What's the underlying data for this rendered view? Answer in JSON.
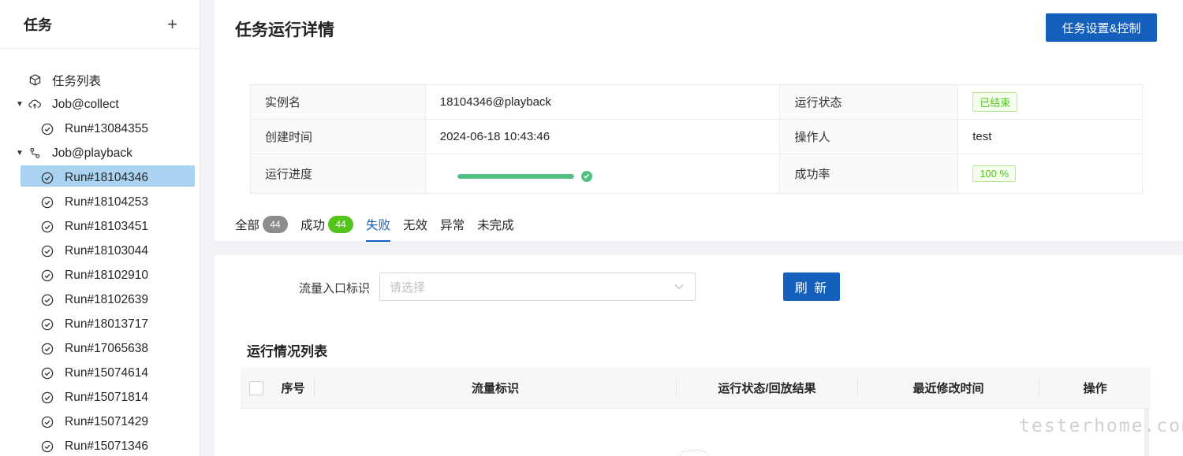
{
  "sidebar": {
    "title": "任务",
    "add_icon": "plus-icon",
    "items": [
      {
        "label": "任务列表",
        "icon": "cube-icon"
      },
      {
        "label": "Job@collect",
        "icon": "cloud-upload-icon"
      },
      {
        "label": "Run#13084355",
        "icon": "check-circle-icon"
      },
      {
        "label": "Job@playback",
        "icon": "branch-icon"
      },
      {
        "label": "Run#18104346",
        "icon": "check-circle-icon",
        "selected": true
      },
      {
        "label": "Run#18104253",
        "icon": "check-circle-icon"
      },
      {
        "label": "Run#18103451",
        "icon": "check-circle-icon"
      },
      {
        "label": "Run#18103044",
        "icon": "check-circle-icon"
      },
      {
        "label": "Run#18102910",
        "icon": "check-circle-icon"
      },
      {
        "label": "Run#18102639",
        "icon": "check-circle-icon"
      },
      {
        "label": "Run#18013717",
        "icon": "check-circle-icon"
      },
      {
        "label": "Run#17065638",
        "icon": "check-circle-icon"
      },
      {
        "label": "Run#15074614",
        "icon": "check-circle-icon"
      },
      {
        "label": "Run#15071814",
        "icon": "check-circle-icon"
      },
      {
        "label": "Run#15071429",
        "icon": "check-circle-icon"
      },
      {
        "label": "Run#15071346",
        "icon": "check-circle-icon"
      }
    ]
  },
  "header": {
    "title": "任务运行详情",
    "settings_button": "任务设置&控制"
  },
  "details": {
    "instance_label": "实例名",
    "instance_value": "18104346@playback",
    "status_label": "运行状态",
    "status_value": "已结束",
    "created_label": "创建时间",
    "created_value": "2024-06-18 10:43:46",
    "operator_label": "操作人",
    "operator_value": "test",
    "progress_label": "运行进度",
    "progress_percent": 100,
    "success_label": "成功率",
    "success_value": "100 %"
  },
  "tabs": [
    {
      "label": "全部",
      "badge": "44",
      "badge_color": "#8c8c8c"
    },
    {
      "label": "成功",
      "badge": "44",
      "badge_color": "#52c41a"
    },
    {
      "label": "失败",
      "active": true
    },
    {
      "label": "无效"
    },
    {
      "label": "异常"
    },
    {
      "label": "未完成"
    }
  ],
  "filter": {
    "label": "流量入口标识",
    "placeholder": "请选择",
    "refresh_button": "刷 新"
  },
  "table": {
    "title": "运行情况列表",
    "columns": [
      "序号",
      "流量标识",
      "运行状态/回放结果",
      "最近修改时间",
      "操作"
    ]
  },
  "watermark": "testerhome.com",
  "colors": {
    "primary": "#1560bd",
    "selected_bg": "#a9d3f0",
    "success": "#52c41a",
    "progress": "#52c085"
  }
}
